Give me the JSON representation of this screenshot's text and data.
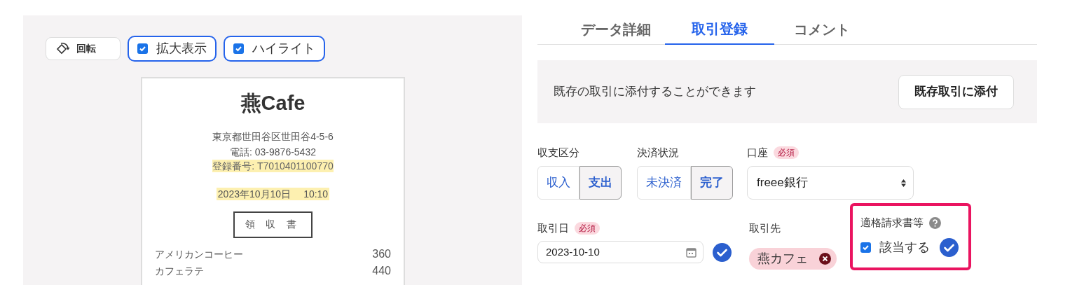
{
  "viewer": {
    "rotate_button": "回転",
    "toggles": [
      {
        "label": "拡大表示",
        "checked": true
      },
      {
        "label": "ハイライト",
        "checked": true
      }
    ]
  },
  "receipt": {
    "shop": "燕Cafe",
    "address": "東京都世田谷区世田谷4-5-6",
    "phone": "電話: 03-9876-5432",
    "registration": {
      "text": "登録番号: T7010401100770",
      "highlighted": true
    },
    "datetime": {
      "date": "2023年10月10日",
      "time": "10:10",
      "highlighted": true
    },
    "title": "領 収 書",
    "items": [
      {
        "name": "アメリカンコーヒー",
        "price": "360"
      },
      {
        "name": "カフェラテ",
        "price": "440"
      }
    ]
  },
  "tabs": [
    {
      "label": "データ詳細",
      "selected": false
    },
    {
      "label": "取引登録",
      "selected": true
    },
    {
      "label": "コメント",
      "selected": false
    }
  ],
  "attach": {
    "text": "既存の取引に添付することができます",
    "button": "既存取引に添付"
  },
  "form": {
    "type": {
      "label": "収支区分",
      "options": [
        {
          "label": "収入",
          "selected": false
        },
        {
          "label": "支出",
          "selected": true
        }
      ]
    },
    "status": {
      "label": "決済状況",
      "options": [
        {
          "label": "未決済",
          "selected": false
        },
        {
          "label": "完了",
          "selected": true
        }
      ]
    },
    "account": {
      "label": "口座",
      "required": "必須",
      "value": "freee銀行"
    },
    "date": {
      "label": "取引日",
      "required": "必須",
      "value": "2023-10-10",
      "confirmed": true
    },
    "partner": {
      "label": "取引先",
      "tag": "燕カフェ"
    },
    "invoice": {
      "label": "適格請求書等",
      "checkbox": "該当する",
      "checked": true,
      "confirmed": true,
      "highlighted": true
    }
  }
}
